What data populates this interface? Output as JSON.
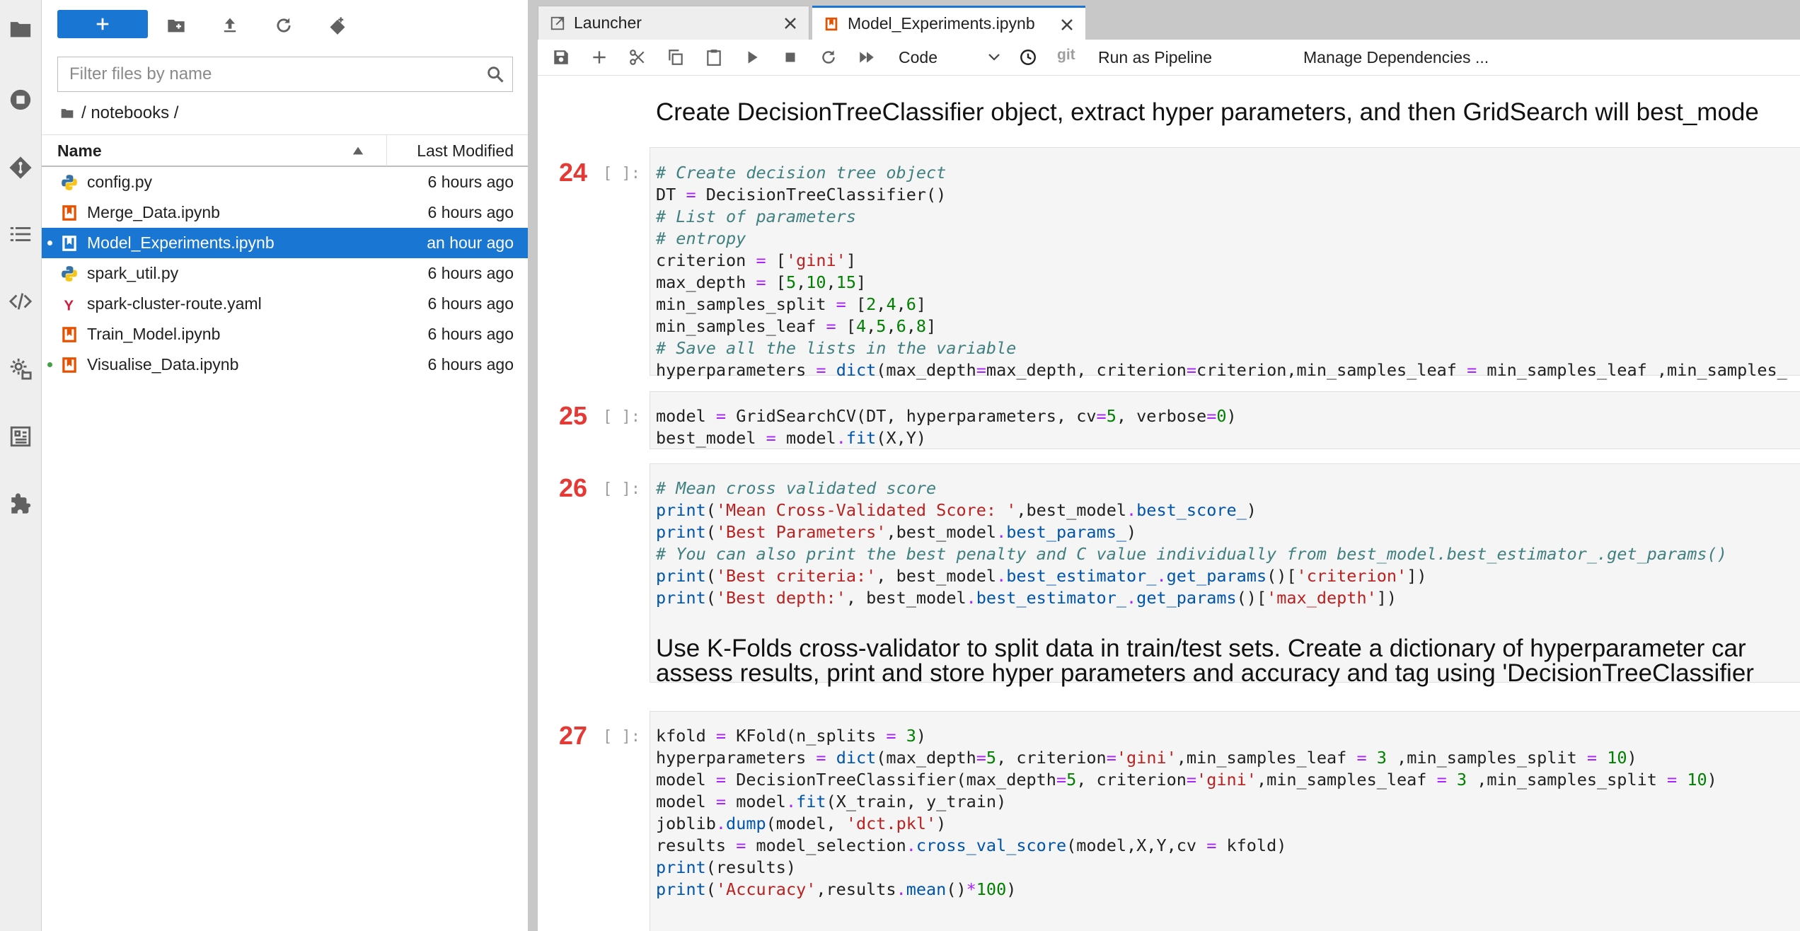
{
  "file_browser": {
    "filter_placeholder": "Filter files by name",
    "breadcrumb": "/ notebooks /",
    "col_name": "Name",
    "col_modified": "Last Modified",
    "files": [
      {
        "name": "config.py",
        "modified": "6 hours ago",
        "icon": "python-icon"
      },
      {
        "name": "Merge_Data.ipynb",
        "modified": "6 hours ago",
        "icon": "notebook-icon"
      },
      {
        "name": "Model_Experiments.ipynb",
        "modified": "an hour ago",
        "icon": "notebook-icon"
      },
      {
        "name": "spark_util.py",
        "modified": "6 hours ago",
        "icon": "python-icon"
      },
      {
        "name": "spark-cluster-route.yaml",
        "modified": "6 hours ago",
        "icon": "yaml-icon"
      },
      {
        "name": "Train_Model.ipynb",
        "modified": "6 hours ago",
        "icon": "notebook-icon"
      },
      {
        "name": "Visualise_Data.ipynb",
        "modified": "6 hours ago",
        "icon": "notebook-icon"
      }
    ]
  },
  "tabs": {
    "launcher": "Launcher",
    "notebook": "Model_Experiments.ipynb"
  },
  "toolbar": {
    "cell_type": "Code",
    "git": "git",
    "run_pipeline": "Run as Pipeline",
    "manage_deps": "Manage Dependencies ..."
  },
  "notebook": {
    "md1": "Create DecisionTreeClassifier object, extract hyper parameters, and then GridSearch will best_mode",
    "md2_line1": "Use K-Folds cross-validator to split data in train/test sets. Create a dictionary of hyperparameter car",
    "md2_line2": "assess results, print and store hyper parameters and accuracy and tag using 'DecisionTreeClassifier",
    "prompt": "[ ]:",
    "cells": [
      {
        "count": "24",
        "lines": [
          [
            [
              "c",
              "# Create decision tree object"
            ]
          ],
          [
            [
              "t",
              "DT "
            ],
            [
              "o",
              "="
            ],
            [
              "t",
              " DecisionTreeClassifier()"
            ]
          ],
          [
            [
              "c",
              "# List of parameters"
            ]
          ],
          [
            [
              "c",
              "# entropy"
            ]
          ],
          [
            [
              "t",
              "criterion "
            ],
            [
              "o",
              "="
            ],
            [
              "t",
              " ["
            ],
            [
              "s",
              "'gini'"
            ],
            [
              "t",
              "]"
            ]
          ],
          [
            [
              "t",
              "max_depth "
            ],
            [
              "o",
              "="
            ],
            [
              "t",
              " ["
            ],
            [
              "n",
              "5"
            ],
            [
              "t",
              ","
            ],
            [
              "n",
              "10"
            ],
            [
              "t",
              ","
            ],
            [
              "n",
              "15"
            ],
            [
              "t",
              "]"
            ]
          ],
          [
            [
              "t",
              "min_samples_split "
            ],
            [
              "o",
              "="
            ],
            [
              "t",
              " ["
            ],
            [
              "n",
              "2"
            ],
            [
              "t",
              ","
            ],
            [
              "n",
              "4"
            ],
            [
              "t",
              ","
            ],
            [
              "n",
              "6"
            ],
            [
              "t",
              "]"
            ]
          ],
          [
            [
              "t",
              "min_samples_leaf "
            ],
            [
              "o",
              "="
            ],
            [
              "t",
              " ["
            ],
            [
              "n",
              "4"
            ],
            [
              "t",
              ","
            ],
            [
              "n",
              "5"
            ],
            [
              "t",
              ","
            ],
            [
              "n",
              "6"
            ],
            [
              "t",
              ","
            ],
            [
              "n",
              "8"
            ],
            [
              "t",
              "]"
            ]
          ],
          [
            [
              "c",
              "# Save all the lists in the variable"
            ]
          ],
          [
            [
              "t",
              "hyperparameters "
            ],
            [
              "o",
              "="
            ],
            [
              "t",
              " "
            ],
            [
              "f",
              "dict"
            ],
            [
              "t",
              "(max_depth"
            ],
            [
              "o",
              "="
            ],
            [
              "t",
              "max_depth, criterion"
            ],
            [
              "o",
              "="
            ],
            [
              "t",
              "criterion,min_samples_leaf "
            ],
            [
              "o",
              "="
            ],
            [
              "t",
              " min_samples_leaf ,min_samples_"
            ]
          ]
        ]
      },
      {
        "count": "25",
        "lines": [
          [
            [
              "t",
              "model "
            ],
            [
              "o",
              "="
            ],
            [
              "t",
              " GridSearchCV(DT, hyperparameters, cv"
            ],
            [
              "o",
              "="
            ],
            [
              "n",
              "5"
            ],
            [
              "t",
              ", verbose"
            ],
            [
              "o",
              "="
            ],
            [
              "n",
              "0"
            ],
            [
              "t",
              ")"
            ]
          ],
          [
            [
              "t",
              "best_model "
            ],
            [
              "o",
              "="
            ],
            [
              "t",
              " model"
            ],
            [
              "o",
              "."
            ],
            [
              "f",
              "fit"
            ],
            [
              "t",
              "(X,Y)"
            ]
          ]
        ]
      },
      {
        "count": "26",
        "lines": [
          [
            [
              "c",
              "# Mean cross validated score"
            ]
          ],
          [
            [
              "f",
              "print"
            ],
            [
              "t",
              "("
            ],
            [
              "s",
              "'Mean Cross-Validated Score: '"
            ],
            [
              "t",
              ",best_model"
            ],
            [
              "o",
              "."
            ],
            [
              "f",
              "best_score_"
            ],
            [
              "t",
              ")"
            ]
          ],
          [
            [
              "f",
              "print"
            ],
            [
              "t",
              "("
            ],
            [
              "s",
              "'Best Parameters'"
            ],
            [
              "t",
              ",best_model"
            ],
            [
              "o",
              "."
            ],
            [
              "f",
              "best_params_"
            ],
            [
              "t",
              ")"
            ]
          ],
          [
            [
              "c",
              "# You can also print the best penalty and C value individually from best_model.best_estimator_.get_params()"
            ]
          ],
          [
            [
              "f",
              "print"
            ],
            [
              "t",
              "("
            ],
            [
              "s",
              "'Best criteria:'"
            ],
            [
              "t",
              ", best_model"
            ],
            [
              "o",
              "."
            ],
            [
              "f",
              "best_estimator_"
            ],
            [
              "o",
              "."
            ],
            [
              "f",
              "get_params"
            ],
            [
              "t",
              "()["
            ],
            [
              "s",
              "'criterion'"
            ],
            [
              "t",
              "])"
            ]
          ],
          [
            [
              "f",
              "print"
            ],
            [
              "t",
              "("
            ],
            [
              "s",
              "'Best depth:'"
            ],
            [
              "t",
              ", best_model"
            ],
            [
              "o",
              "."
            ],
            [
              "f",
              "best_estimator_"
            ],
            [
              "o",
              "."
            ],
            [
              "f",
              "get_params"
            ],
            [
              "t",
              "()["
            ],
            [
              "s",
              "'max_depth'"
            ],
            [
              "t",
              "])"
            ]
          ]
        ]
      },
      {
        "count": "27",
        "lines": [
          [
            [
              "t",
              "kfold "
            ],
            [
              "o",
              "="
            ],
            [
              "t",
              " KFold(n_splits "
            ],
            [
              "o",
              "="
            ],
            [
              "t",
              " "
            ],
            [
              "n",
              "3"
            ],
            [
              "t",
              ")"
            ]
          ],
          [
            [
              "t",
              "hyperparameters "
            ],
            [
              "o",
              "="
            ],
            [
              "t",
              " "
            ],
            [
              "f",
              "dict"
            ],
            [
              "t",
              "(max_depth"
            ],
            [
              "o",
              "="
            ],
            [
              "n",
              "5"
            ],
            [
              "t",
              ", criterion"
            ],
            [
              "o",
              "="
            ],
            [
              "s",
              "'gini'"
            ],
            [
              "t",
              ",min_samples_leaf "
            ],
            [
              "o",
              "="
            ],
            [
              "t",
              " "
            ],
            [
              "n",
              "3"
            ],
            [
              "t",
              " ,min_samples_split "
            ],
            [
              "o",
              "="
            ],
            [
              "t",
              " "
            ],
            [
              "n",
              "10"
            ],
            [
              "t",
              ")"
            ]
          ],
          [
            [
              "t",
              "model "
            ],
            [
              "o",
              "="
            ],
            [
              "t",
              " DecisionTreeClassifier(max_depth"
            ],
            [
              "o",
              "="
            ],
            [
              "n",
              "5"
            ],
            [
              "t",
              ", criterion"
            ],
            [
              "o",
              "="
            ],
            [
              "s",
              "'gini'"
            ],
            [
              "t",
              ",min_samples_leaf "
            ],
            [
              "o",
              "="
            ],
            [
              "t",
              " "
            ],
            [
              "n",
              "3"
            ],
            [
              "t",
              " ,min_samples_split "
            ],
            [
              "o",
              "="
            ],
            [
              "t",
              " "
            ],
            [
              "n",
              "10"
            ],
            [
              "t",
              ")"
            ]
          ],
          [
            [
              "t",
              "model "
            ],
            [
              "o",
              "="
            ],
            [
              "t",
              " model"
            ],
            [
              "o",
              "."
            ],
            [
              "f",
              "fit"
            ],
            [
              "t",
              "(X_train, y_train)"
            ]
          ],
          [
            [
              "t",
              "joblib"
            ],
            [
              "o",
              "."
            ],
            [
              "f",
              "dump"
            ],
            [
              "t",
              "(model, "
            ],
            [
              "s",
              "'dct.pkl'"
            ],
            [
              "t",
              ")"
            ]
          ],
          [
            [
              "t",
              "results "
            ],
            [
              "o",
              "="
            ],
            [
              "t",
              " model_selection"
            ],
            [
              "o",
              "."
            ],
            [
              "f",
              "cross_val_score"
            ],
            [
              "t",
              "(model,X,Y,cv "
            ],
            [
              "o",
              "="
            ],
            [
              "t",
              " kfold)"
            ]
          ],
          [
            [
              "f",
              "print"
            ],
            [
              "t",
              "(results)"
            ]
          ],
          [
            [
              "f",
              "print"
            ],
            [
              "t",
              "("
            ],
            [
              "s",
              "'Accuracy'"
            ],
            [
              "t",
              ",results"
            ],
            [
              "o",
              "."
            ],
            [
              "f",
              "mean"
            ],
            [
              "t",
              "()"
            ],
            [
              "o",
              "*"
            ],
            [
              "n",
              "100"
            ],
            [
              "t",
              ")"
            ]
          ]
        ]
      }
    ]
  }
}
